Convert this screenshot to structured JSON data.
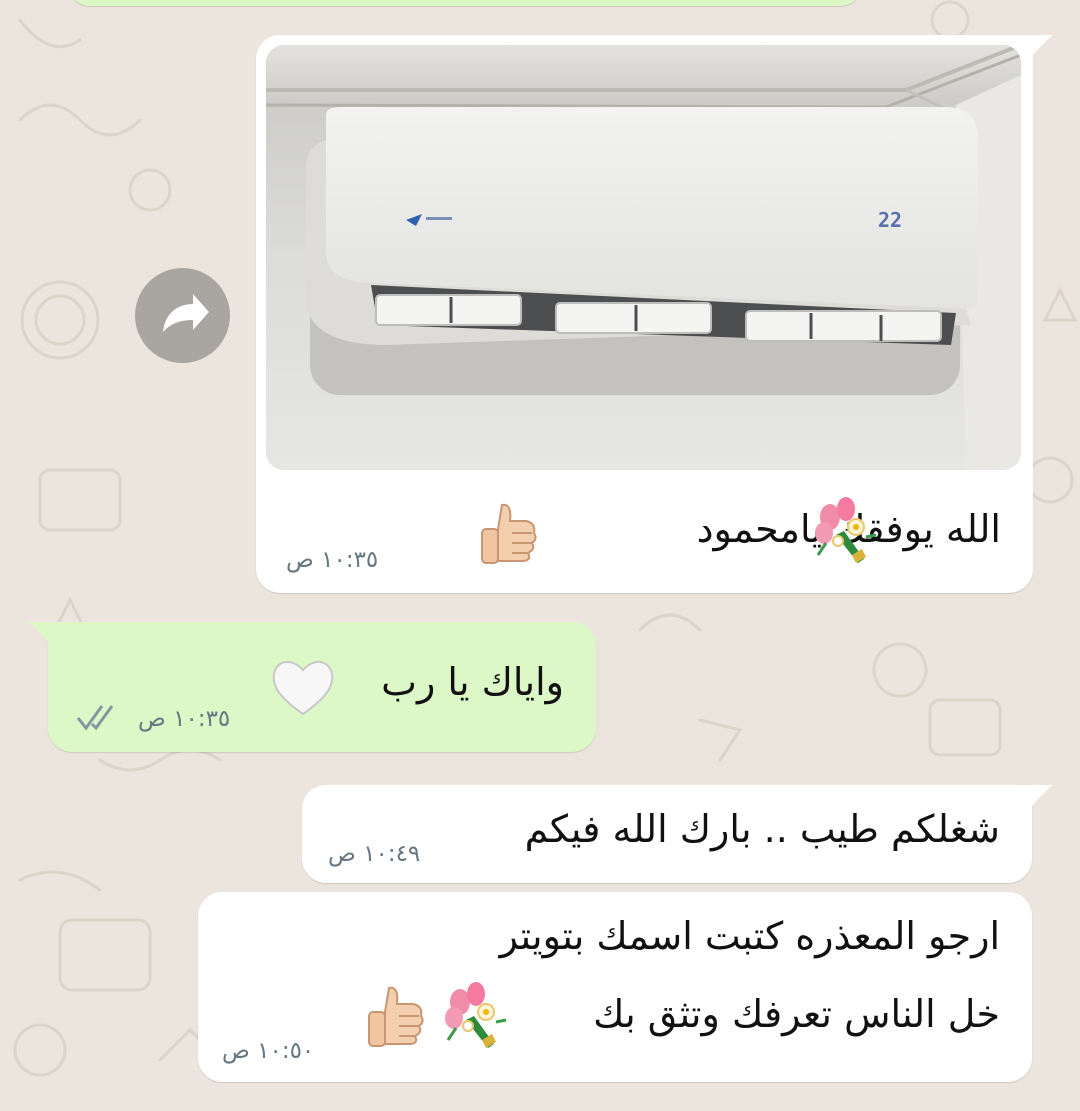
{
  "chat": {
    "messages": [
      {
        "type": "image",
        "direction": "incoming",
        "caption": "الله يوفقك يامحمود",
        "time": "١٠:٣٥ ص",
        "display_number": "22",
        "emojis": [
          "bouquet",
          "thumbs-up"
        ]
      },
      {
        "type": "text",
        "direction": "outgoing",
        "text": "واياك يا رب",
        "time": "١٠:٣٥ ص",
        "status": "read",
        "emojis": [
          "white-heart"
        ]
      },
      {
        "type": "text",
        "direction": "incoming",
        "text": "شغلكم طيب .. بارك الله فيكم",
        "time": "١٠:٤٩ ص"
      },
      {
        "type": "text",
        "direction": "incoming",
        "lines": [
          "ارجو المعذره كتبت اسمك بتويتر",
          "خل الناس تعرفك وتثق بك"
        ],
        "time": "١٠:٥٠ ص",
        "emojis": [
          "bouquet",
          "thumbs-up"
        ]
      }
    ]
  },
  "icons": {
    "forward": "forward-arrow-icon",
    "read_receipt": "double-check-icon"
  },
  "colors": {
    "wallpaper": "#ece5dd",
    "incoming": "#ffffff",
    "outgoing": "#dcf8c6",
    "time": "#667781",
    "read_tick": "#8696a0"
  }
}
